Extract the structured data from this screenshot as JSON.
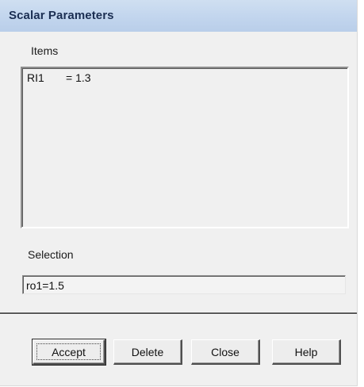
{
  "window": {
    "title": "Scalar Parameters"
  },
  "items_section": {
    "label": "Items",
    "list": [
      {
        "name": "RI1",
        "value": "= 1.3"
      }
    ]
  },
  "selection_section": {
    "label": "Selection",
    "value": "ro1=1.5"
  },
  "buttons": {
    "accept": "Accept",
    "delete": "Delete",
    "close": "Close",
    "help": "Help"
  }
}
